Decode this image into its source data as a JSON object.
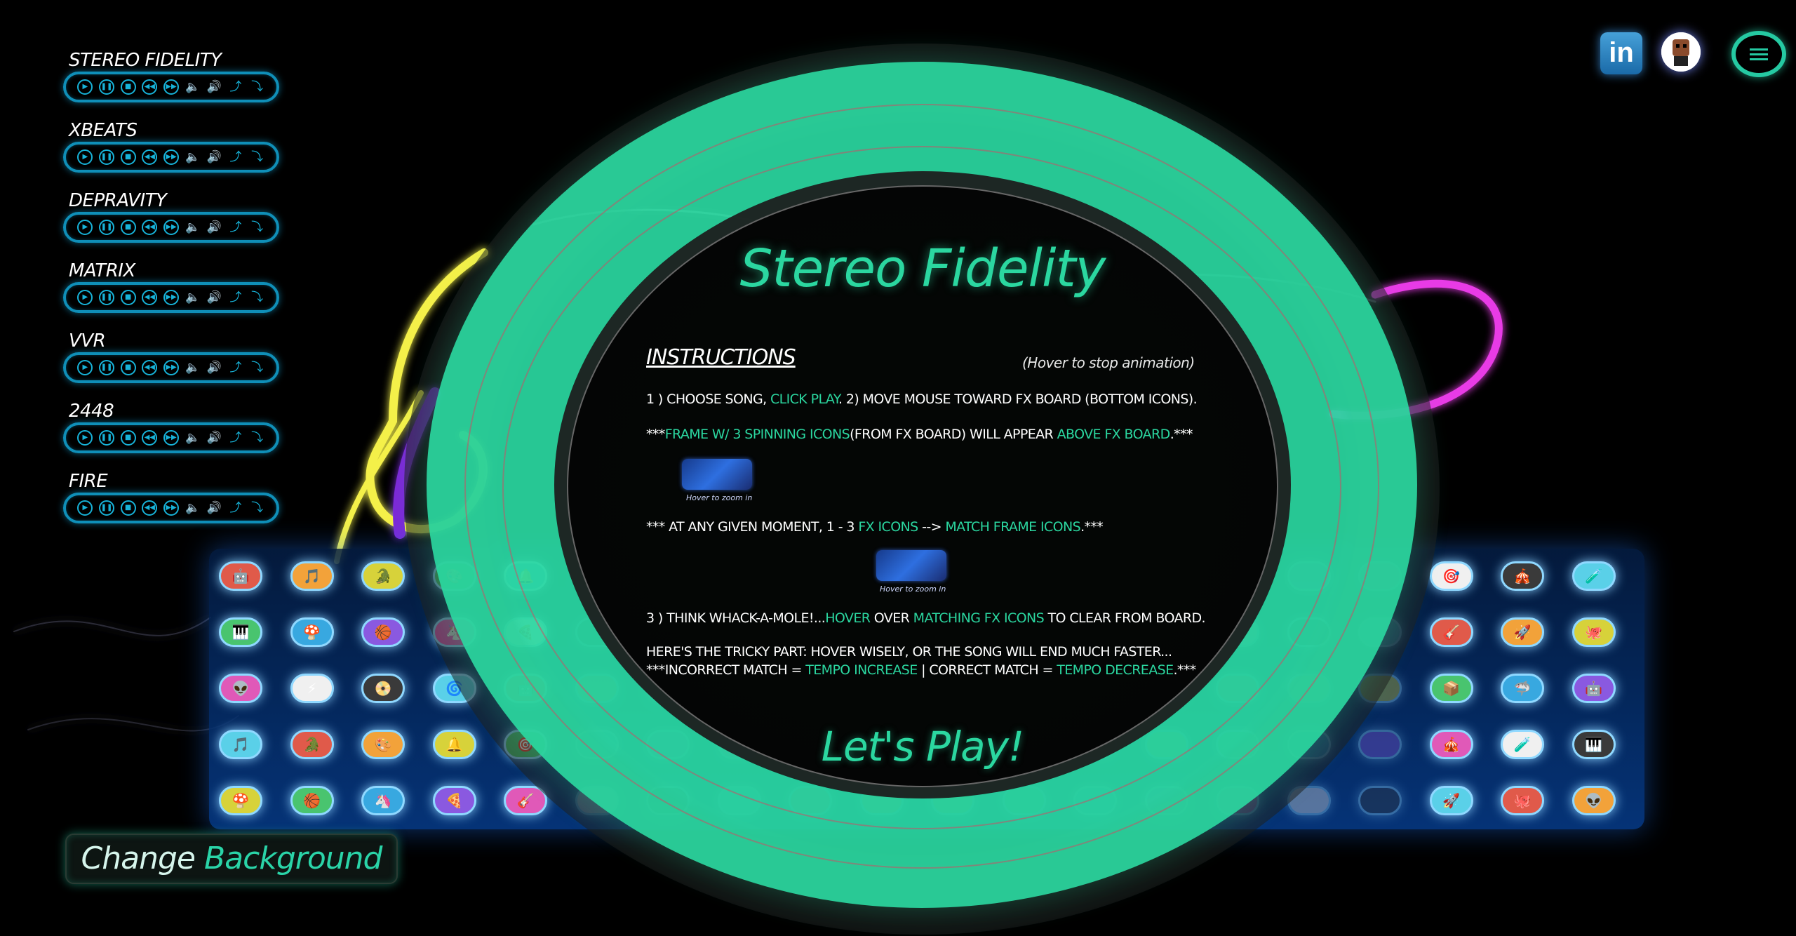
{
  "tracks": [
    {
      "title": "STEREO FIDELITY"
    },
    {
      "title": "XBEATS"
    },
    {
      "title": "DEPRAVITY"
    },
    {
      "title": "MATRIX"
    },
    {
      "title": "VVR"
    },
    {
      "title": "2448"
    },
    {
      "title": "FIRE"
    }
  ],
  "track_controls": [
    {
      "name": "play-icon",
      "glyph": "▶"
    },
    {
      "name": "pause-icon",
      "glyph": "❚❚"
    },
    {
      "name": "stop-icon",
      "glyph": "■"
    },
    {
      "name": "rewind-icon",
      "glyph": "◀◀"
    },
    {
      "name": "fast-forward-icon",
      "glyph": "▶▶"
    },
    {
      "name": "volume-down-icon",
      "glyph": "🔈"
    },
    {
      "name": "volume-up-icon",
      "glyph": "🔊"
    },
    {
      "name": "tempo-up-icon",
      "glyph": "⤴"
    },
    {
      "name": "tempo-down-icon",
      "glyph": "⤵"
    }
  ],
  "header": {
    "linkedin_label": "in"
  },
  "modal": {
    "title": "Stereo Fidelity",
    "instructions_heading": "INSTRUCTIONS",
    "hover_note": "(Hover to stop animation)",
    "step1": {
      "a": "1 ) CHOOSE SONG, ",
      "b": "CLICK PLAY",
      "c": ". 2) MOVE MOUSE TOWARD FX BOARD (BOTTOM ICONS)."
    },
    "step1b": {
      "a": "***",
      "b": "FRAME W/ 3 SPINNING ICONS",
      "c": "(FROM FX BOARD) WILL APPEAR ",
      "d": "ABOVE FX BOARD",
      "e": ".***"
    },
    "thumb_caption": "Hover to zoom in",
    "step2": {
      "a": "*** AT ANY GIVEN MOMENT, 1 - 3 ",
      "b": "FX ICONS",
      "c": " --> ",
      "d": "MATCH FRAME ICONS",
      "e": ".***"
    },
    "step3": {
      "a": "3 ) THINK WHACK-A-MOLE!...",
      "b": "HOVER",
      "c": " OVER ",
      "d": "MATCHING FX ICONS",
      "e": " TO CLEAR FROM BOARD."
    },
    "tricky": "HERE'S THE TRICKY PART: HOVER WISELY, OR THE SONG WILL END MUCH FASTER...",
    "rule": {
      "a": "***INCORRECT MATCH = ",
      "b": "TEMPO INCREASE",
      "c": " | CORRECT MATCH = ",
      "d": "TEMPO DECREASE",
      "e": ".***"
    },
    "play_label": "Let's Play!"
  },
  "change_background": {
    "word1": "Change",
    "word2": "Background"
  },
  "fx_icons": [
    {
      "glyph": "🤖"
    },
    {
      "glyph": "🎵"
    },
    {
      "glyph": "🐊"
    },
    {
      "glyph": "🎨"
    },
    {
      "glyph": "🔔"
    },
    {
      "glyph": "🎯"
    },
    {
      "glyph": "🎪"
    },
    {
      "glyph": "🧪"
    },
    {
      "glyph": "🎹"
    },
    {
      "glyph": "🍄"
    },
    {
      "glyph": "🏀"
    },
    {
      "glyph": "🦄"
    },
    {
      "glyph": "🍕"
    },
    {
      "glyph": "🎸"
    },
    {
      "glyph": "🚀"
    },
    {
      "glyph": "🐙"
    },
    {
      "glyph": "👽"
    },
    {
      "glyph": "⚡"
    },
    {
      "glyph": "📀"
    },
    {
      "glyph": "🌀"
    },
    {
      "glyph": "🤖"
    },
    {
      "glyph": "📦"
    },
    {
      "glyph": "🦈"
    }
  ],
  "colors": {
    "accent": "#2bd7a0",
    "control_blue": "#17b3d9",
    "board_blue": "#0a3c8c"
  }
}
